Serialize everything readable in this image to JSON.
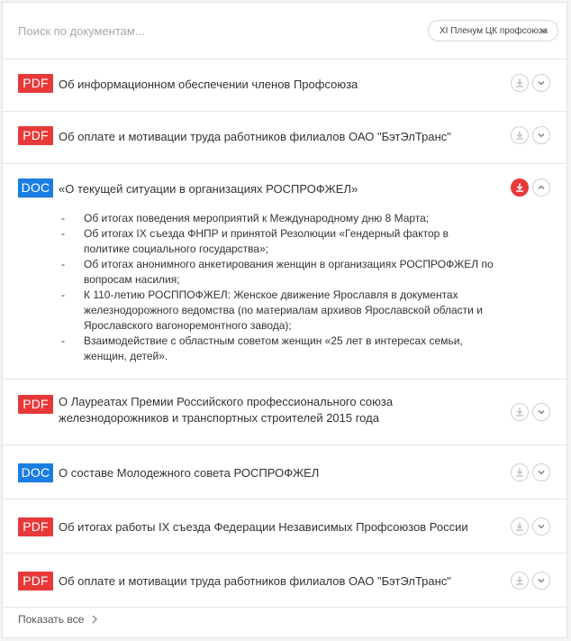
{
  "search": {
    "placeholder": "Поиск по документам..."
  },
  "filter": {
    "label": "XI Пленум ЦК профсоюза"
  },
  "documents": [
    {
      "type": "PDF",
      "title": "Об информационном обеспечении членов Профсоюза"
    },
    {
      "type": "PDF",
      "title": "Об оплате и мотивации труда работников филиалов ОАО \"БэтЭлТранс\""
    },
    {
      "type": "DOC",
      "title": "«О текущей ситуации в организациях РОСПРОФЖЕЛ»",
      "items": [
        "Об итогах поведения мероприятий к Международному дню 8 Марта;",
        "Об итогах IX съезда ФНПР и принятой Резолюции «Гендерный фактор в политике социального государства»;",
        "Об итогах анонимного анкетирования женщин в организациях РОСПРОФЖЕЛ по вопросам насилия;",
        "К 110-летию РОСППОФЖЕЛ: Женское движение Ярославля в документах железнодорожного ведомства (по материалам архивов Ярославской области и Ярославского вагоноремонтного завода);",
        "Взаимодействие с областным советом женщин «25 лет в интересах семьи, женщин, детей»."
      ]
    },
    {
      "type": "PDF",
      "title": "О Лауреатах Премии Российского профессионального союза железнодорожников и транспортных строителей 2015 года"
    },
    {
      "type": "DOC",
      "title": "О составе Молодежного совета РОСПРОФЖЕЛ"
    },
    {
      "type": "PDF",
      "title": "Об итогах работы IX съезда Федерации Независимых Профсоюзов России"
    },
    {
      "type": "PDF",
      "title": "Об оплате и мотивации труда работников филиалов ОАО \"БэтЭлТранс\""
    }
  ],
  "footer": {
    "show_all": "Показать все"
  },
  "colors": {
    "pdf": "#e8393a",
    "doc": "#1a7de4",
    "active_download": "#e8393a"
  }
}
